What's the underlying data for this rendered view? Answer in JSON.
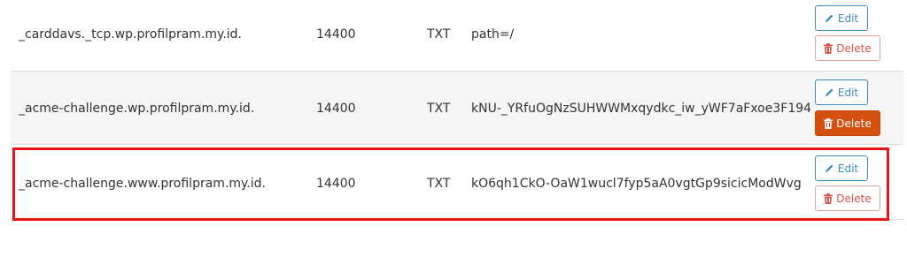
{
  "records": [
    {
      "name": "_carddavs._tcp.wp.profilpram.my.id.",
      "ttl": "14400",
      "type": "TXT",
      "record": "path=/",
      "edit_label": "Edit",
      "delete_label": "Delete"
    },
    {
      "name": "_acme-challenge.wp.profilpram.my.id.",
      "ttl": "14400",
      "type": "TXT",
      "record": "kNU-_YRfuOgNzSUHWWMxqydkc_iw_yWF7aFxoe3F194",
      "edit_label": "Edit",
      "delete_label": "Delete"
    },
    {
      "name": "_acme-challenge.www.profilpram.my.id.",
      "ttl": "14400",
      "type": "TXT",
      "record": "kO6qh1CkO-OaW1wucl7fyp5aA0vgtGp9sicicModWvg",
      "edit_label": "Edit",
      "delete_label": "Delete"
    }
  ],
  "colors": {
    "highlight": "#e8141a",
    "edit": "#3c8dbc",
    "delete": "#d9534f",
    "delete_active": "#d54f0f"
  },
  "icons": {
    "edit": "pencil-icon",
    "delete": "trash-icon"
  }
}
